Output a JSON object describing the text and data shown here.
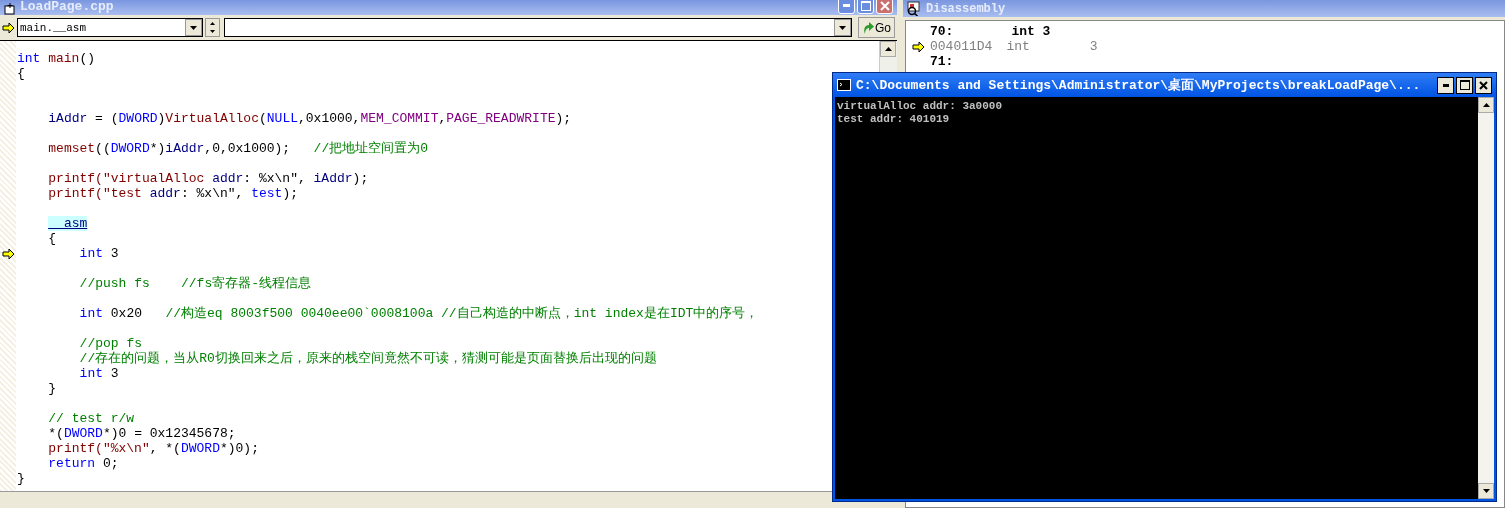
{
  "editor": {
    "title": "LoadPage.cpp",
    "function_combo": "main.__asm",
    "go_button": "Go",
    "lines": [
      {
        "current": false,
        "tokens": [
          {
            "kind": "keyword",
            "text": "int "
          },
          {
            "kind": "function",
            "text": "main"
          },
          {
            "kind": "plain",
            "text": "()"
          }
        ]
      },
      {
        "current": false,
        "tokens": [
          {
            "kind": "plain",
            "text": "{"
          }
        ],
        "children": [
          {
            "current": false
          },
          {
            "current": false
          },
          {
            "current": false,
            "tokens": [
              {
                "kind": "ident",
                "text": "iAddr"
              },
              {
                "kind": "plain",
                "text": " = ("
              },
              {
                "kind": "keyword",
                "text": "DWORD"
              },
              {
                "kind": "plain",
                "text": ")"
              },
              {
                "kind": "function",
                "text": "VirtualAlloc"
              },
              {
                "kind": "plain",
                "text": "("
              },
              {
                "kind": "keyword",
                "text": "NULL"
              },
              {
                "kind": "plain",
                "text": ",0x1000,"
              },
              {
                "kind": "macro",
                "text": "MEM_COMMIT"
              },
              {
                "kind": "plain",
                "text": ","
              },
              {
                "kind": "macro",
                "text": "PAGE_READWRITE"
              },
              {
                "kind": "plain",
                "text": ");"
              }
            ]
          },
          {
            "current": false
          },
          {
            "current": false,
            "tokens": [
              {
                "kind": "function",
                "text": "memset"
              },
              {
                "kind": "plain",
                "text": "(("
              },
              {
                "kind": "keyword",
                "text": "DWORD"
              },
              {
                "kind": "plain",
                "text": "*)"
              },
              {
                "kind": "ident",
                "text": "iAddr"
              },
              {
                "kind": "plain",
                "text": ",0,0x1000);   "
              },
              {
                "kind": "comment",
                "text": "//把地址空间置为0"
              }
            ]
          },
          {
            "current": false
          },
          {
            "current": false,
            "tokens": [
              {
                "kind": "function",
                "text": "printf(\"virtualAlloc "
              },
              {
                "kind": "ident",
                "text": "addr"
              },
              {
                "kind": "plain",
                "text": ": %x\\n\", "
              },
              {
                "kind": "ident",
                "text": "iAddr"
              },
              {
                "kind": "plain",
                "text": ");"
              }
            ]
          },
          {
            "current": false,
            "tokens": [
              {
                "kind": "function",
                "text": "printf(\"test "
              },
              {
                "kind": "ident",
                "text": "addr"
              },
              {
                "kind": "plain",
                "text": ": %x\\n\", "
              },
              {
                "kind": "keyword",
                "text": "test"
              },
              {
                "kind": "plain",
                "text": ");"
              }
            ]
          },
          {
            "current": false
          },
          {
            "current": false,
            "tokens": [
              {
                "kind": "highlight",
                "text": "__asm"
              }
            ]
          },
          {
            "current": false,
            "tokens": [
              {
                "kind": "plain",
                "text": "{"
              }
            ],
            "children": [
              {
                "current": true,
                "tokens": [
                  {
                    "kind": "keyword",
                    "text": "int "
                  },
                  {
                    "kind": "plain",
                    "text": "3"
                  }
                ]
              },
              {
                "current": false
              },
              {
                "current": false,
                "tokens": [
                  {
                    "kind": "comment",
                    "text": "//push fs    //fs寄存器-线程信息"
                  }
                ]
              },
              {
                "current": false
              },
              {
                "current": false,
                "tokens": [
                  {
                    "kind": "keyword",
                    "text": "int "
                  },
                  {
                    "kind": "plain",
                    "text": "0x20   "
                  },
                  {
                    "kind": "comment",
                    "text": "//构造eq 8003f500 0040ee00`0008100a //自己构造的中断点，int index是在IDT中的序号，"
                  }
                ]
              },
              {
                "current": false
              },
              {
                "current": false,
                "tokens": [
                  {
                    "kind": "comment",
                    "text": "//pop fs"
                  }
                ]
              },
              {
                "current": false,
                "tokens": [
                  {
                    "kind": "comment",
                    "text": "//存在的问题，当从R0切换回来之后，原来的栈空间竟然不可读，猜测可能是页面替换后出现的问题"
                  }
                ]
              },
              {
                "current": false,
                "tokens": [
                  {
                    "kind": "keyword",
                    "text": "int "
                  },
                  {
                    "kind": "plain",
                    "text": "3"
                  }
                ]
              }
            ]
          },
          {
            "current": false,
            "tokens": [
              {
                "kind": "plain",
                "text": "}"
              }
            ]
          },
          {
            "current": false
          },
          {
            "current": false,
            "tokens": [
              {
                "kind": "comment",
                "text": "// test r/w"
              }
            ]
          },
          {
            "current": false,
            "tokens": [
              {
                "kind": "plain",
                "text": "*("
              },
              {
                "kind": "keyword",
                "text": "DWORD"
              },
              {
                "kind": "plain",
                "text": "*)0 = 0x12345678;"
              }
            ]
          },
          {
            "current": false,
            "tokens": [
              {
                "kind": "function",
                "text": "printf(\"%x\\n\""
              },
              {
                "kind": "plain",
                "text": ", *("
              },
              {
                "kind": "keyword",
                "text": "DWORD"
              },
              {
                "kind": "plain",
                "text": "*)0);"
              }
            ]
          },
          {
            "current": false,
            "tokens": [
              {
                "kind": "keyword",
                "text": "return "
              },
              {
                "kind": "plain",
                "text": "0;"
              }
            ]
          }
        ]
      },
      {
        "current": false,
        "tokens": [
          {
            "kind": "plain",
            "text": "}"
          }
        ]
      }
    ]
  },
  "disassembly": {
    "title": "Disassembly",
    "rows": [
      {
        "kind": "source",
        "current": false,
        "line": "70:",
        "code": "int 3"
      },
      {
        "kind": "instruction",
        "current": true,
        "address": "004011D4",
        "mnemonic": "int",
        "operand": "3"
      },
      {
        "kind": "source",
        "current": false,
        "line": "71:"
      }
    ]
  },
  "console": {
    "title": "C:\\Documents and Settings\\Administrator\\桌面\\MyProjects\\breakLoadPage\\...",
    "lines": [
      "virtualAlloc addr: 3a0000",
      "test addr: 401019"
    ]
  }
}
